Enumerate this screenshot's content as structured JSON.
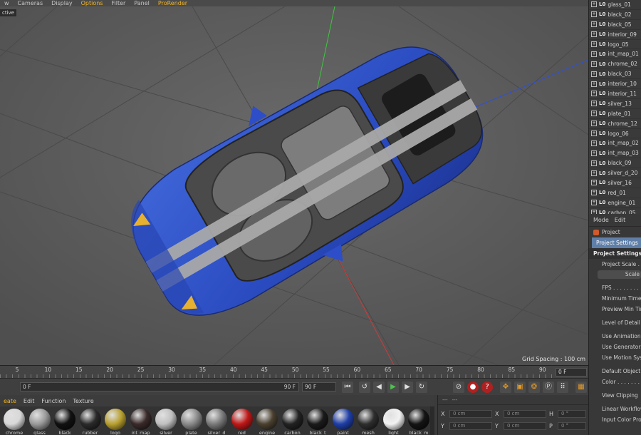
{
  "viewport_menu": {
    "items": [
      {
        "label": "w",
        "highlight": false
      },
      {
        "label": "Cameras",
        "highlight": false
      },
      {
        "label": "Display",
        "highlight": false
      },
      {
        "label": "Options",
        "highlight": true
      },
      {
        "label": "Filter",
        "highlight": false
      },
      {
        "label": "Panel",
        "highlight": false
      },
      {
        "label": "ProRender",
        "highlight": true
      }
    ]
  },
  "viewport": {
    "label": "ctive",
    "grid_spacing": "Grid Spacing : 100 cm"
  },
  "objects": [
    "glass_01",
    "black_02",
    "black_05",
    "interior_09",
    "logo_05",
    "int_map_01",
    "chrome_02",
    "black_03",
    "interior_10",
    "interior_11",
    "silver_13",
    "plate_01",
    "chrome_12",
    "logo_06",
    "int_map_02",
    "int_map_03",
    "black_09",
    "silver_d_20",
    "silver_16",
    "red_01",
    "engine_01",
    "carbon_05"
  ],
  "attributes": {
    "tabs": [
      "Mode",
      "Edit"
    ],
    "project_label": "Project",
    "selected_tab": "Project Settings",
    "section_title": "Project Settings",
    "rows_1": [
      "Project Scale . . ."
    ],
    "scale_button": "Scale",
    "rows_2": [
      "FPS . . . . . . . . . .",
      "Minimum Time",
      "Preview Min Tim"
    ],
    "rows_3": [
      "Level of Detail . ."
    ],
    "rows_4": [
      "Use Animation",
      "Use Generators",
      "Use Motion Sys"
    ],
    "rows_5": [
      "Default Object C",
      "Color . . . . . . . ."
    ],
    "rows_6": [
      "View Clipping"
    ],
    "rows_7": [
      "Linear Workflow",
      "Input Color Pro"
    ]
  },
  "timeline": {
    "ticks": [
      "5",
      "10",
      "15",
      "20",
      "25",
      "30",
      "35",
      "40",
      "45",
      "50",
      "55",
      "60",
      "65",
      "70",
      "75",
      "80",
      "85",
      "90"
    ],
    "current_frame": "0 F"
  },
  "transport": {
    "start_field": "0 F",
    "end_field": "90 F",
    "end_field2": "90 F"
  },
  "material_menu": {
    "items": [
      {
        "label": "eate",
        "highlight": true
      },
      {
        "label": "Edit",
        "highlight": false
      },
      {
        "label": "Function",
        "highlight": false
      },
      {
        "label": "Texture",
        "highlight": false
      }
    ]
  },
  "materials": [
    {
      "name": "chrome",
      "color": "#d8d8d8"
    },
    {
      "name": "glass",
      "color": "#9a9a9a"
    },
    {
      "name": "black",
      "color": "#111111"
    },
    {
      "name": "rubber",
      "color": "#2a2a2a"
    },
    {
      "name": "logo",
      "color": "#b8a030"
    },
    {
      "name": "int_map",
      "color": "#3a2a2a"
    },
    {
      "name": "silver",
      "color": "#c0c0c0"
    },
    {
      "name": "plate",
      "color": "#8a8a8a"
    },
    {
      "name": "silver_d",
      "color": "#7a7a7a"
    },
    {
      "name": "red",
      "color": "#c01818"
    },
    {
      "name": "engine",
      "color": "#4a4030"
    },
    {
      "name": "carbon",
      "color": "#222222"
    },
    {
      "name": "black_t",
      "color": "#1a1a1a"
    },
    {
      "name": "paint",
      "color": "#1f3fa8"
    },
    {
      "name": "mesh",
      "color": "#2e2e2e"
    },
    {
      "name": "light",
      "color": "#f2f2f2"
    },
    {
      "name": "black_m",
      "color": "#141414"
    }
  ],
  "coordinates": {
    "header": [
      "---",
      "---"
    ],
    "rows": [
      {
        "a1": "X",
        "v1": "0 cm",
        "a2": "X",
        "v2": "0 cm",
        "a3": "H",
        "v3": "0 °"
      },
      {
        "a1": "Y",
        "v1": "0 cm",
        "a2": "Y",
        "v2": "0 cm",
        "a3": "P",
        "v3": "0 °"
      }
    ]
  }
}
